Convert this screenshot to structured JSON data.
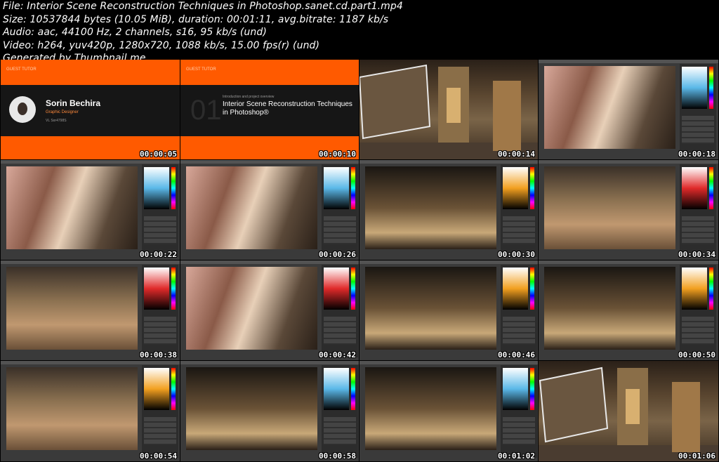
{
  "header": {
    "lines": [
      "File: Interior Scene Reconstruction Techniques in Photoshop.sanet.cd.part1.mp4",
      "Size: 10537844 bytes (10.05 MiB), duration: 00:01:11, avg.bitrate: 1187 kb/s",
      "Audio: aac, 44100 Hz, 2 channels, s16, 95 kb/s (und)",
      "Video: h264, yuv420p, 1280x720, 1088 kb/s, 15.00 fps(r) (und)",
      "Generated by Thumbnail me"
    ]
  },
  "slide1": {
    "tag": "GUEST TUTOR",
    "name": "Sorin Bechira",
    "role": "Graphic Designer",
    "handle": "VL Sor4798S"
  },
  "slide2": {
    "tag": "GUEST TUTOR",
    "number": "01",
    "subtitle": "Introduction and project overview",
    "title": "Interior Scene Reconstruction Techniques in Photoshop®"
  },
  "thumbs": [
    {
      "ts": "00:00:05",
      "kind": "slide1"
    },
    {
      "ts": "00:00:10",
      "kind": "slide2"
    },
    {
      "ts": "00:00:14",
      "kind": "cathedral"
    },
    {
      "ts": "00:00:18",
      "kind": "ps"
    },
    {
      "ts": "00:00:22",
      "kind": "ps"
    },
    {
      "ts": "00:00:26",
      "kind": "ps"
    },
    {
      "ts": "00:00:30",
      "kind": "ps"
    },
    {
      "ts": "00:00:34",
      "kind": "ps"
    },
    {
      "ts": "00:00:38",
      "kind": "ps"
    },
    {
      "ts": "00:00:42",
      "kind": "ps"
    },
    {
      "ts": "00:00:46",
      "kind": "ps"
    },
    {
      "ts": "00:00:50",
      "kind": "ps"
    },
    {
      "ts": "00:00:54",
      "kind": "ps"
    },
    {
      "ts": "00:00:58",
      "kind": "ps"
    },
    {
      "ts": "00:01:02",
      "kind": "ps"
    },
    {
      "ts": "00:01:06",
      "kind": "cathedral"
    }
  ]
}
